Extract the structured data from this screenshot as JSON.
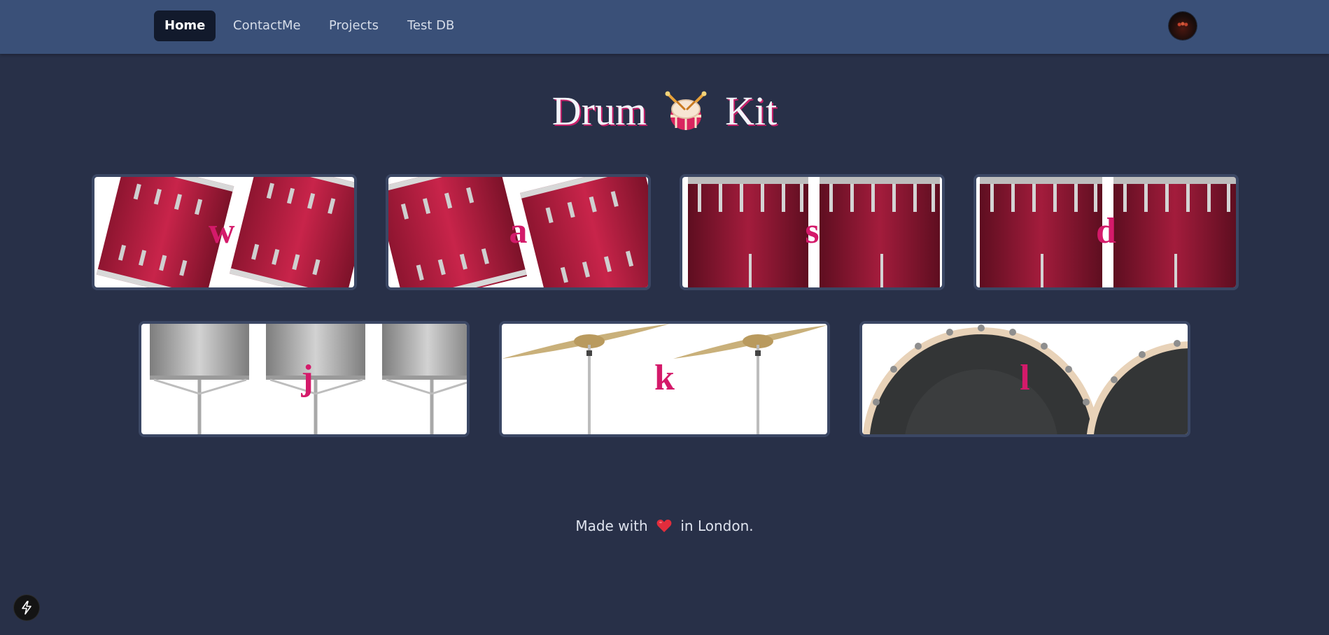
{
  "nav": {
    "items": [
      {
        "label": "Home",
        "active": true
      },
      {
        "label": "ContactMe",
        "active": false
      },
      {
        "label": "Projects",
        "active": false
      },
      {
        "label": "Test DB",
        "active": false
      }
    ],
    "avatar_icon": "profile-avatar"
  },
  "title": {
    "word1": "Drum",
    "word2": "Kit",
    "icon": "drum-emoji"
  },
  "pads": [
    {
      "key": "w",
      "image": "tom-drums"
    },
    {
      "key": "a",
      "image": "tom-drums"
    },
    {
      "key": "s",
      "image": "floor-tom-drums"
    },
    {
      "key": "d",
      "image": "floor-tom-drums"
    },
    {
      "key": "j",
      "image": "snare-drums"
    },
    {
      "key": "k",
      "image": "crash-cymbals"
    },
    {
      "key": "l",
      "image": "kick-drum"
    }
  ],
  "footer": {
    "prefix": "Made with",
    "icon": "heart-icon",
    "suffix": "in London."
  },
  "dev_button_icon": "lightning-bolt-icon",
  "colors": {
    "background": "#283048",
    "navbar": "#3a5078",
    "active_nav": "#121a2c",
    "key_letter": "#d41a6a",
    "drum_red": "#b31d3e"
  }
}
